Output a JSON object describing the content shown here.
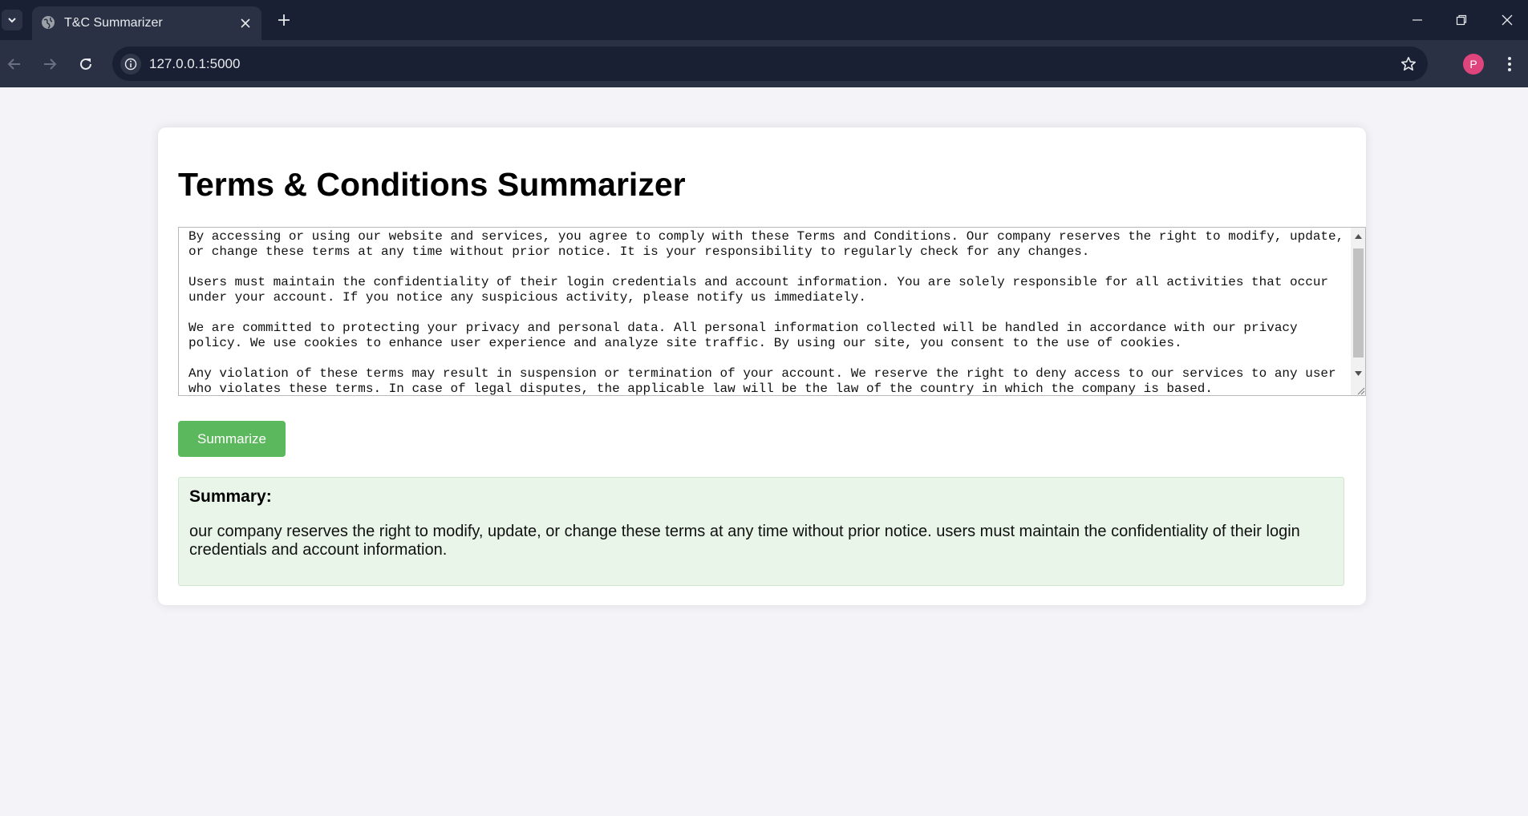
{
  "browser": {
    "tab_title": "T&C Summarizer",
    "url": "127.0.0.1:5000",
    "profile_initial": "P",
    "icons": [
      "tab-search-icon",
      "globe-icon",
      "close-icon",
      "plus-icon",
      "minimize-icon",
      "restore-icon",
      "window-close-icon",
      "back-arrow-icon",
      "forward-arrow-icon",
      "reload-icon",
      "site-info-icon",
      "bookmark-star-icon",
      "kebab-menu-icon"
    ]
  },
  "page": {
    "title": "Terms & Conditions Summarizer",
    "terms_text": "By accessing or using our website and services, you agree to comply with these Terms and Conditions. Our company reserves the right to modify, update, or change these terms at any time without prior notice. It is your responsibility to regularly check for any changes.\n\nUsers must maintain the confidentiality of their login credentials and account information. You are solely responsible for all activities that occur under your account. If you notice any suspicious activity, please notify us immediately.\n\nWe are committed to protecting your privacy and personal data. All personal information collected will be handled in accordance with our privacy policy. We use cookies to enhance user experience and analyze site traffic. By using our site, you consent to the use of cookies.\n\nAny violation of these terms may result in suspension or termination of your account. We reserve the right to deny access to our services to any user who violates these terms. In case of legal disputes, the applicable law will be the law of the country in which the company is based.",
    "summarize_label": "Summarize",
    "summary_heading": "Summary:",
    "summary_text": "our company reserves the right to modify, update, or change these terms at any time without prior notice. users must maintain the confidentiality of their login credentials and account information."
  },
  "colors": {
    "chrome_bg": "#192033",
    "toolbar_bg": "#2a3144",
    "page_bg": "#f4f4f8",
    "button_green": "#5cb85c",
    "summary_bg": "#e8f5e8",
    "avatar_pink": "#e0447c"
  }
}
